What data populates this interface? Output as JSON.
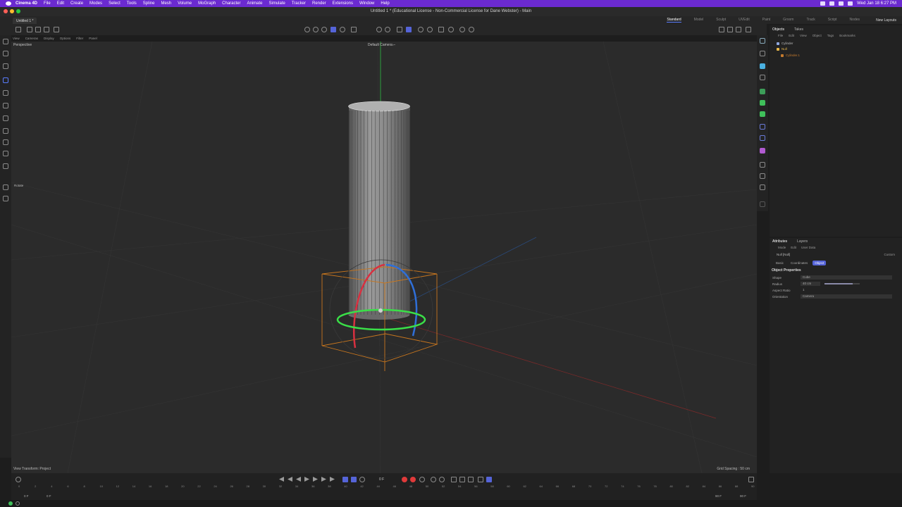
{
  "menubar": {
    "app_name": "Cinema 4D",
    "items": [
      "File",
      "Edit",
      "Create",
      "Modes",
      "Select",
      "Tools",
      "Spline",
      "Mesh",
      "Volume",
      "MoGraph",
      "Character",
      "Animate",
      "Simulate",
      "Tracker",
      "Render",
      "Extensions",
      "Window",
      "Help"
    ],
    "clock": "Wed Jan 18  6:27 PM"
  },
  "window": {
    "title": "Untitled 1 * (Educational License - Non-Commercial License for Dane Webster) - Main",
    "tab": "Untitled 1 *"
  },
  "layouts": {
    "items": [
      "Standard",
      "Model",
      "Sculpt",
      "UVEdit",
      "Paint",
      "Groom",
      "Track",
      "Script",
      "Nodes"
    ],
    "active": "Standard",
    "new_layouts": "New Layouts"
  },
  "viewport": {
    "menu": [
      "View",
      "Cameras",
      "Display",
      "Options",
      "Filter",
      "Panel"
    ],
    "name": "Perspective",
    "camera": "Default Camera ⌐",
    "tool_hint": "Rotate",
    "status": "View Transform: Project",
    "grid_spacing": "Grid Spacing : 50 cm"
  },
  "objects": {
    "tabs": [
      "Objects",
      "Takes"
    ],
    "active_tab": "Objects",
    "menu": [
      "File",
      "Edit",
      "View",
      "Object",
      "Tags",
      "Bookmarks"
    ],
    "items": [
      {
        "name": "Cylinder",
        "color": "#8fa8e0"
      },
      {
        "name": "Null",
        "color": "#e8b84a"
      },
      {
        "name": "Cylinder.1",
        "color": "#c47a2e"
      }
    ]
  },
  "attributes": {
    "tabs": [
      "Attributes",
      "Layers"
    ],
    "active_tab": "Attributes",
    "menu": [
      "Mode",
      "Edit",
      "User Data"
    ],
    "object_name": "Null [Null]",
    "preset": "Custom",
    "subtabs": [
      "Basic",
      "Coordinates",
      "Object"
    ],
    "active_subtab": "Object",
    "section": "Object Properties",
    "props": [
      {
        "label": "Shape",
        "value": "Cube"
      },
      {
        "label": "Radius",
        "value": "40 cm"
      },
      {
        "label": "Aspect Ratio",
        "value": "1"
      },
      {
        "label": "Orientation",
        "value": "Camera"
      }
    ],
    "radius_slider_fraction": 0.8
  },
  "timeline": {
    "current_frame": "0 F",
    "start": "0 F",
    "start2": "0 F",
    "end": "90 F",
    "end2": "90 F",
    "ticks": [
      "0",
      "2",
      "4",
      "6",
      "8",
      "10",
      "12",
      "14",
      "16",
      "18",
      "20",
      "22",
      "24",
      "26",
      "28",
      "30",
      "32",
      "34",
      "36",
      "38",
      "40",
      "42",
      "44",
      "46",
      "48",
      "50",
      "52",
      "54",
      "56",
      "58",
      "60",
      "62",
      "64",
      "66",
      "68",
      "70",
      "72",
      "74",
      "76",
      "78",
      "80",
      "82",
      "84",
      "86",
      "88",
      "90"
    ]
  }
}
